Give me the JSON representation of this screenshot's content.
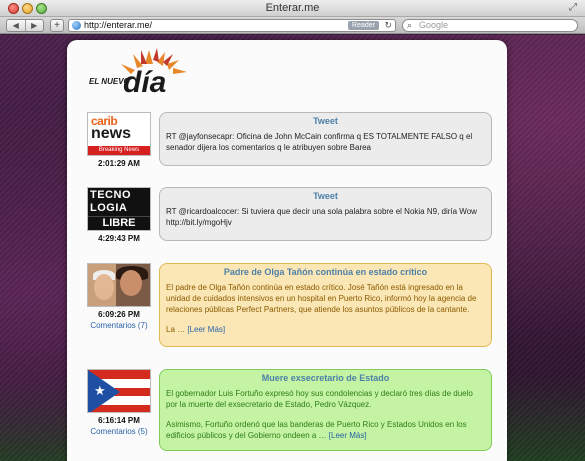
{
  "window": {
    "title": "Enterar.me",
    "fullscreen_icon": "fullscreen-arrows-icon"
  },
  "toolbar": {
    "back_icon": "◀",
    "forward_icon": "▶",
    "add_icon": "+",
    "url": "http://enterar.me/",
    "reader_label": "Reader",
    "reload_icon": "↻",
    "search_icon": "⌕",
    "search_placeholder": "Google"
  },
  "logo": {
    "small_text": "EL NUEVO",
    "big_text": "día",
    "colors": {
      "sun": "#e8872a",
      "text": "#1a1a1a",
      "accent": "#c0392b"
    }
  },
  "items": [
    {
      "thumb": {
        "line1": "carib",
        "line2": "news",
        "line3": "Breaking News"
      },
      "time": "2:01:29 AM",
      "title": "Tweet",
      "body": "RT @jayfonsecapr: Oficina de John McCain confirma q ES TOTALMENTE FALSO q el senador dijera los comentarios q le atribuyen sobre Barea"
    },
    {
      "thumb": {
        "line1": "TECNO",
        "line2": "LOGIA",
        "line3": "LIBRE"
      },
      "time": "4:29:43 PM",
      "title": "Tweet",
      "body": "RT @ricardoalcocer: Si tuviera que decir una sola palabra sobre el Nokia N9, diría Wow",
      "link": "http://bit.ly/mgoHjv"
    },
    {
      "time": "6:09:26 PM",
      "comments": "Comentarios (7)",
      "title": "Padre de Olga Tañón continúa en estado crítico",
      "body": "El padre de Olga Tañón continúa en estado crítico. José Tañón está ingresado en la unidad de cuidados intensivos en un hospital en Puerto Rico, informó hoy la agencia de relaciones públicas Perfect Partners, que atiende los asuntos públicos de la cantante.",
      "more_prefix": "La … ",
      "more": "[Leer Más]"
    },
    {
      "time": "6:16:14 PM",
      "comments": "Comentarios (5)",
      "title": "Muere exsecretario de Estado",
      "body": "El gobernador Luis Fortuño expresó hoy sus condolencias y  declaró tres días de duelo por la muerte del exsecretario de Estado, Pedro Vázquez.",
      "body2": "Asimismo, Fortuño ordenó que las banderas de Puerto Rico y Estados Unidos en los edificios públicos y del Gobierno ondeen a … ",
      "more": "[Leer Más]"
    }
  ],
  "colors": {
    "tweet_bg": "#ececec",
    "news_yellow": "#fbe7b5",
    "news_green": "#c4f3a3",
    "title_blue": "#4d7fa8",
    "link_blue": "#2a63a8"
  }
}
